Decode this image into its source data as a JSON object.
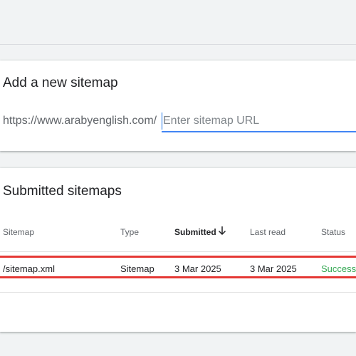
{
  "add_card": {
    "title": "Add a new sitemap",
    "url_prefix": "https://www.arabyenglish.com/",
    "input_placeholder": "Enter sitemap URL",
    "input_value": ""
  },
  "submitted_card": {
    "title": "Submitted sitemaps",
    "columns": {
      "sitemap": "Sitemap",
      "type": "Type",
      "submitted": "Submitted",
      "last_read": "Last read",
      "status": "Status"
    },
    "sort_icon": "arrow-down-icon",
    "rows": [
      {
        "sitemap": "/sitemap.xml",
        "type": "Sitemap",
        "submitted": "3 Mar 2025",
        "last_read": "3 Mar 2025",
        "status": "Success"
      }
    ]
  },
  "colors": {
    "accent": "#1a73e8",
    "status_success": "#34a853",
    "highlight": "#e53935"
  }
}
